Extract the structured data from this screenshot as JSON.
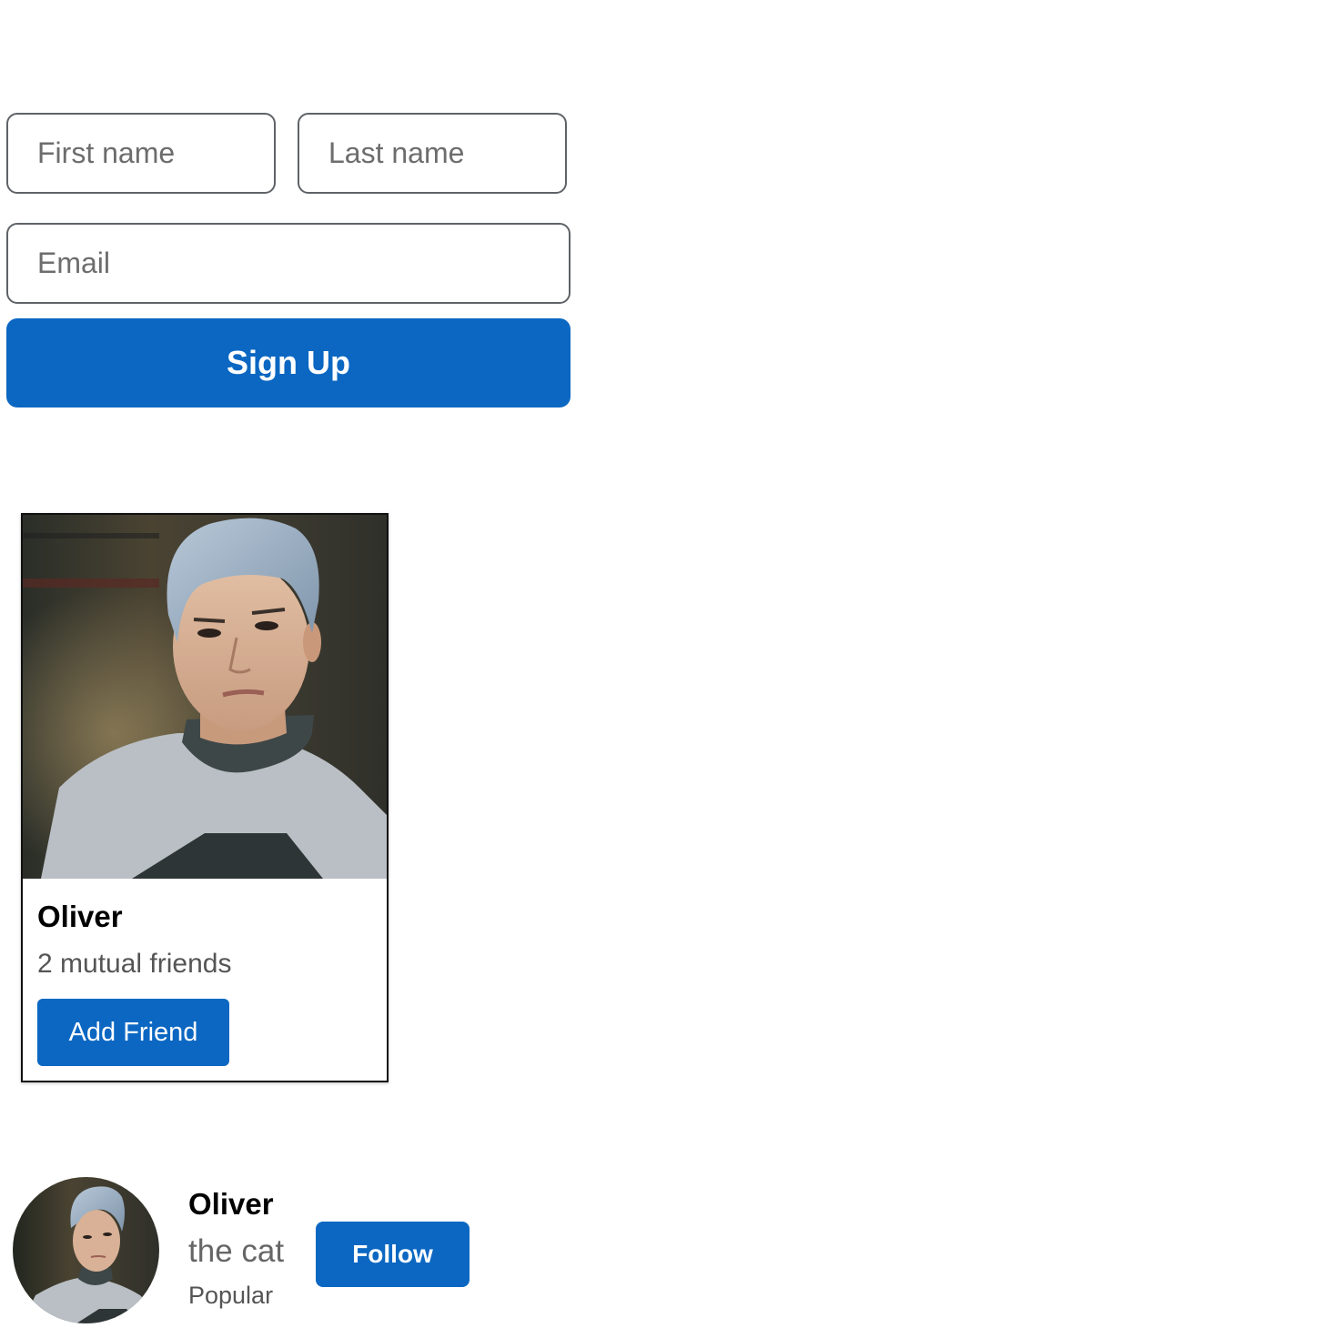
{
  "signup": {
    "first_name_placeholder": "First name",
    "last_name_placeholder": "Last name",
    "email_placeholder": "Email",
    "submit_label": "Sign Up"
  },
  "friend_card": {
    "name": "Oliver",
    "mutual_friends": "2 mutual friends",
    "add_button_label": "Add Friend",
    "photo_description": "portrait-photo"
  },
  "profile": {
    "name": "Oliver",
    "tagline": "the cat",
    "status": "Popular",
    "follow_button_label": "Follow"
  },
  "colors": {
    "accent": "#0b67c2",
    "text_muted": "#555555",
    "border": "#5f6368"
  }
}
